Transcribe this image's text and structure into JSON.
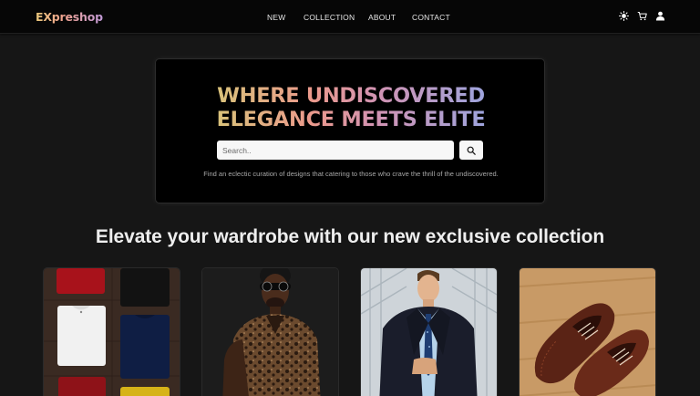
{
  "brand": {
    "logo": "EXpreshop"
  },
  "nav": {
    "links": [
      {
        "label": "NEW"
      },
      {
        "label": "COLLECTION"
      },
      {
        "label": "ABOUT"
      },
      {
        "label": "CONTACT"
      }
    ],
    "icons": [
      "sun-icon",
      "cart-icon",
      "user-icon"
    ]
  },
  "hero": {
    "title_line1": "WHERE UNDISCOVERED",
    "title_line2": "ELEGANCE MEETS ELITE",
    "search_placeholder": "Search..",
    "subtitle": "Find an eclectic curation of designs that catering to those who crave the thrill of the undiscovered."
  },
  "collection": {
    "title": "Elevate your wardrobe with our new exclusive collection",
    "cards": [
      {
        "image": "folded-tshirts-image"
      },
      {
        "image": "man-sunglasses-image"
      },
      {
        "image": "man-suit-image"
      },
      {
        "image": "brown-shoes-image"
      }
    ]
  },
  "colors": {
    "background": "#161616",
    "navbar": "#060606",
    "hero_panel": "#000000",
    "gradient_gold": "#d9c27a",
    "gradient_pink": "#eb9a8c",
    "gradient_blue": "#9ea4dd"
  }
}
